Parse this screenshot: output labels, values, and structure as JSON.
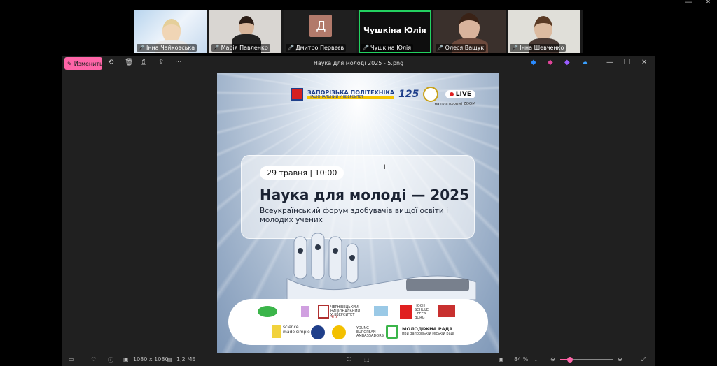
{
  "participants": [
    {
      "name": "Інна Чайковська"
    },
    {
      "name": "Марія Павленко"
    },
    {
      "name": "Дмитро Первєєв",
      "initial": "Д"
    },
    {
      "name": "Чушкіна Юлія",
      "display": "Чушкіна Юлія",
      "active": true
    },
    {
      "name": "Олеся Ващук"
    },
    {
      "name": "Інна Шевченко"
    }
  ],
  "viewer": {
    "edit_label": "Изменить",
    "title": "Наука для молоді 2025 - 5.png",
    "status": {
      "dimensions": "1080 x 1080",
      "filesize": "1,2 МБ",
      "zoom": "84 %",
      "zoom_fraction": 0.18
    }
  },
  "poster": {
    "logo_text_1": "ЗАПОРІЗЬКА ПОЛІТЕХНІКА",
    "logo_text_2": "НАЦІОНАЛЬНИЙ УНІВЕРСИТЕТ",
    "logo_125": "125",
    "live_label": "LIVE",
    "platform": "на платформі ZOOM",
    "date": "29 травня | 10:00",
    "heading": "Наука для молоді — 2025",
    "subtitle": "Всеукраїнський форум здобувачів вищої освіти і молодих учених",
    "partners": {
      "p1": "ЧЕРНІВЕЦЬКИЙ НАЦІОНАЛЬНИЙ УНІВЕРСИТЕТ",
      "p1b": "ЧНУ",
      "p2": "HOCH SCHULE OFFEN BURG",
      "p3": "science made simple",
      "p4": "YOUNG EUROPEAN AMBASSADORS",
      "p5": "МОЛОДІЖНА РАДА",
      "p5b": "при Запорізькій міській раді"
    }
  }
}
